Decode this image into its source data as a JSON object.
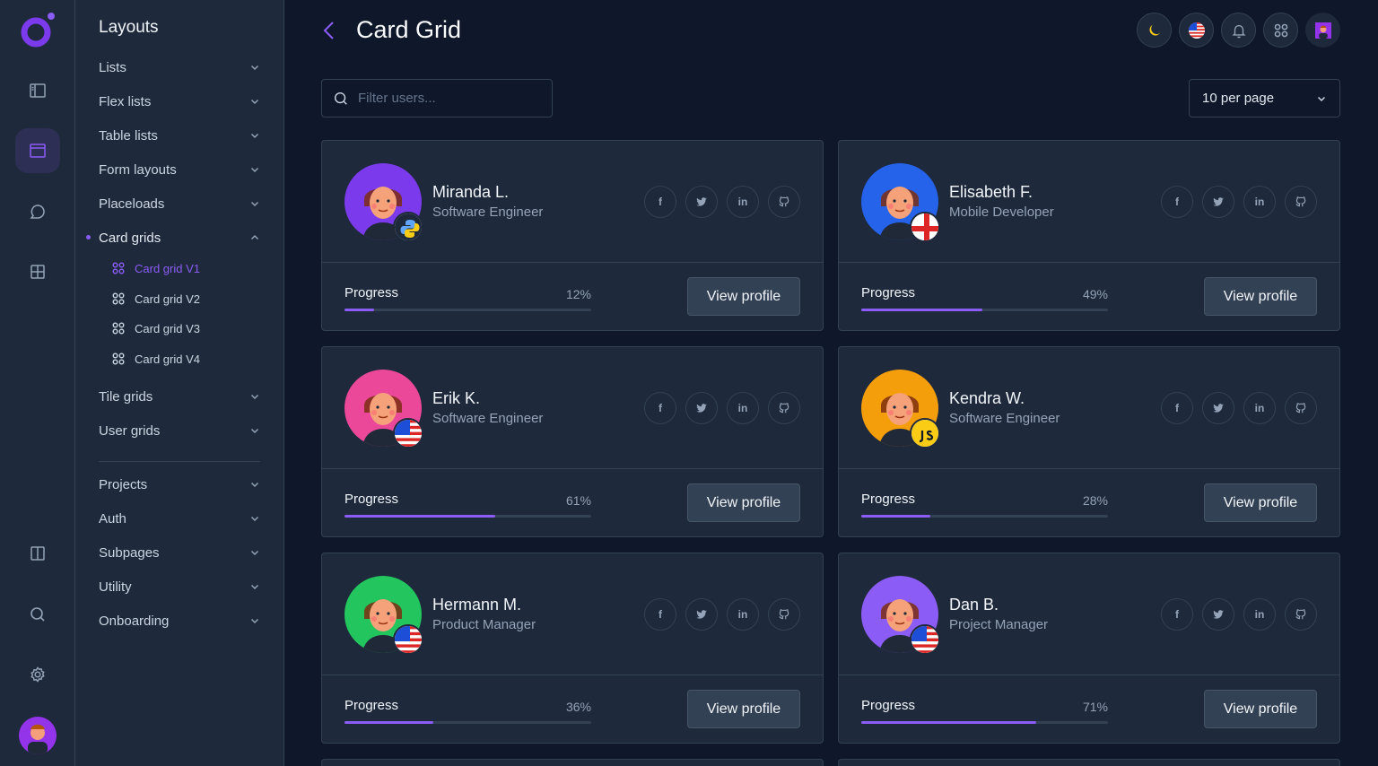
{
  "sidebar": {
    "title": "Layouts",
    "items": [
      {
        "label": "Lists"
      },
      {
        "label": "Flex lists"
      },
      {
        "label": "Table lists"
      },
      {
        "label": "Form layouts"
      },
      {
        "label": "Placeloads"
      },
      {
        "label": "Card grids"
      },
      {
        "label": "Tile grids"
      },
      {
        "label": "User grids"
      },
      {
        "label": "Projects"
      },
      {
        "label": "Auth"
      },
      {
        "label": "Subpages"
      },
      {
        "label": "Utility"
      },
      {
        "label": "Onboarding"
      }
    ],
    "subitems": [
      {
        "label": "Card grid V1"
      },
      {
        "label": "Card grid V2"
      },
      {
        "label": "Card grid V3"
      },
      {
        "label": "Card grid V4"
      }
    ]
  },
  "header": {
    "title": "Card Grid"
  },
  "filter": {
    "placeholder": "Filter users..."
  },
  "pagination": {
    "per_page": "10 per page"
  },
  "progress_label": "Progress",
  "view_profile_label": "View profile",
  "social": {
    "facebook": "f",
    "linkedin": "in"
  },
  "users": [
    {
      "name": "Miranda L.",
      "role": "Software Engineer",
      "progress": 12,
      "progress_text": "12%",
      "avatar_bg": "#7c3aed",
      "badge": "python"
    },
    {
      "name": "Elisabeth F.",
      "role": "Mobile Developer",
      "progress": 49,
      "progress_text": "49%",
      "avatar_bg": "#2563eb",
      "badge": "england"
    },
    {
      "name": "Erik K.",
      "role": "Software Engineer",
      "progress": 61,
      "progress_text": "61%",
      "avatar_bg": "#ec4899",
      "badge": "usa"
    },
    {
      "name": "Kendra W.",
      "role": "Software Engineer",
      "progress": 28,
      "progress_text": "28%",
      "avatar_bg": "#f59e0b",
      "badge": "js"
    },
    {
      "name": "Hermann M.",
      "role": "Product Manager",
      "progress": 36,
      "progress_text": "36%",
      "avatar_bg": "#22c55e",
      "badge": "usa"
    },
    {
      "name": "Dan B.",
      "role": "Project Manager",
      "progress": 71,
      "progress_text": "71%",
      "avatar_bg": "#8b5cf6",
      "badge": "usa"
    }
  ],
  "colors": {
    "accent": "#8b5cf6",
    "bg": "#0f172a",
    "panel": "#1e293b",
    "border": "#334155"
  }
}
